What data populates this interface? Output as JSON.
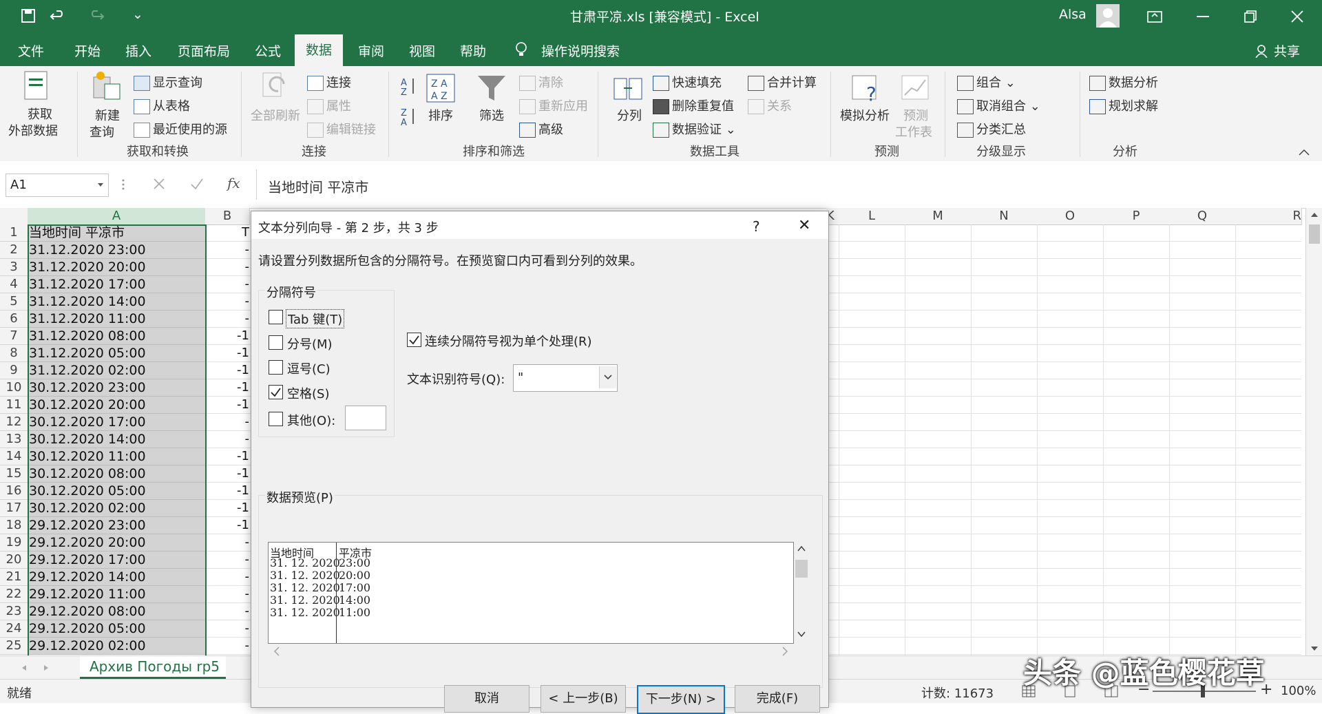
{
  "titlebar": {
    "title": "甘肃平凉.xls [兼容模式] - Excel",
    "user": "Alsa",
    "qat_dropdown": "⌄"
  },
  "tabs": [
    "文件",
    "开始",
    "插入",
    "页面布局",
    "公式",
    "数据",
    "审阅",
    "视图",
    "帮助",
    "操作说明搜索"
  ],
  "share_label": "共享",
  "ribbon": {
    "get_data": "获取\n外部数据",
    "get_data_line1": "获取",
    "get_data_line2": "外部数据",
    "new_query_line1": "新建",
    "new_query_line2": "查询",
    "show_queries": "显示查询",
    "from_table": "从表格",
    "recent_sources": "最近使用的源",
    "group_get_transform": "获取和转换",
    "refresh_all": "全部刷新",
    "connections": "连接",
    "properties": "属性",
    "edit_links": "编辑链接",
    "group_connections": "连接",
    "sort": "排序",
    "filter": "筛选",
    "clear": "清除",
    "reapply": "重新应用",
    "advanced": "高级",
    "group_sort_filter": "排序和筛选",
    "text_to_columns": "分列",
    "flash_fill": "快速填充",
    "remove_duplicates": "删除重复值",
    "data_validation": "数据验证",
    "consolidate": "合并计算",
    "relationships": "关系",
    "group_data_tools": "数据工具",
    "what_if": "模拟分析",
    "forecast_line1": "预测",
    "forecast_line2": "工作表",
    "group_forecast": "预测",
    "group_btn": "组合",
    "ungroup_btn": "取消组合",
    "subtotal": "分类汇总",
    "group_outline": "分级显示",
    "data_analysis": "数据分析",
    "solver": "规划求解",
    "group_analysis": "分析"
  },
  "formula_bar": {
    "name_box": "A1",
    "fx": "fx",
    "content": "当地时间 平凉市"
  },
  "columns": [
    "A",
    "B",
    "K",
    "L",
    "M",
    "N",
    "O",
    "P",
    "Q",
    "R"
  ],
  "rows": [
    {
      "n": "1",
      "a": "当地时间 平凉市",
      "b": "T"
    },
    {
      "n": "2",
      "a": "31.12.2020 23:00",
      "b": "-"
    },
    {
      "n": "3",
      "a": "31.12.2020 20:00",
      "b": "-"
    },
    {
      "n": "4",
      "a": "31.12.2020 17:00",
      "b": "-"
    },
    {
      "n": "5",
      "a": "31.12.2020 14:00",
      "b": "-"
    },
    {
      "n": "6",
      "a": "31.12.2020 11:00",
      "b": "-"
    },
    {
      "n": "7",
      "a": "31.12.2020 08:00",
      "b": "-1"
    },
    {
      "n": "8",
      "a": "31.12.2020 05:00",
      "b": "-1"
    },
    {
      "n": "9",
      "a": "31.12.2020 02:00",
      "b": "-1"
    },
    {
      "n": "10",
      "a": "30.12.2020 23:00",
      "b": "-1"
    },
    {
      "n": "11",
      "a": "30.12.2020 20:00",
      "b": "-1"
    },
    {
      "n": "12",
      "a": "30.12.2020 17:00",
      "b": "-"
    },
    {
      "n": "13",
      "a": "30.12.2020 14:00",
      "b": "-"
    },
    {
      "n": "14",
      "a": "30.12.2020 11:00",
      "b": "-1"
    },
    {
      "n": "15",
      "a": "30.12.2020 08:00",
      "b": "-1"
    },
    {
      "n": "16",
      "a": "30.12.2020 05:00",
      "b": "-1"
    },
    {
      "n": "17",
      "a": "30.12.2020 02:00",
      "b": "-1"
    },
    {
      "n": "18",
      "a": "29.12.2020 23:00",
      "b": "-1"
    },
    {
      "n": "19",
      "a": "29.12.2020 20:00",
      "b": "-"
    },
    {
      "n": "20",
      "a": "29.12.2020 17:00",
      "b": "-"
    },
    {
      "n": "21",
      "a": "29.12.2020 14:00",
      "b": "-"
    },
    {
      "n": "22",
      "a": "29.12.2020 11:00",
      "b": "-"
    },
    {
      "n": "23",
      "a": "29.12.2020 08:00",
      "b": "-"
    },
    {
      "n": "24",
      "a": "29.12.2020 05:00",
      "b": "-"
    },
    {
      "n": "25",
      "a": "29.12.2020 02:00",
      "b": "-"
    }
  ],
  "sheet_tab": "Архив Погоды rp5",
  "status": {
    "ready": "就绪",
    "count": "计数: 11673",
    "zoom": "100%",
    "minus": "−",
    "plus": "+"
  },
  "dialog": {
    "title": "文本分列向导 - 第 2 步，共 3 步",
    "help": "?",
    "close": "✕",
    "instruction": "请设置分列数据所包含的分隔符号。在预览窗口内可看到分列的效果。",
    "delimiters_group": "分隔符号",
    "tab_label": "Tab 键(T)",
    "semicolon_label": "分号(M)",
    "comma_label": "逗号(C)",
    "space_label": "空格(S)",
    "other_label": "其他(O):",
    "consecutive_label": "连续分隔符号视为单个处理(R)",
    "qualifier_label": "文本识别符号(Q):",
    "qualifier_value": "\"",
    "preview_label": "数据预览(P)",
    "preview_col1": [
      "当地时间",
      "31. 12. 2020",
      "31. 12. 2020",
      "31. 12. 2020",
      "31. 12. 2020",
      "31. 12. 2020"
    ],
    "preview_col2": [
      "平凉市",
      "23:00",
      "20:00",
      "17:00",
      "14:00",
      "11:00"
    ],
    "cancel": "取消",
    "back": "< 上一步(B)",
    "next": "下一步(N) >",
    "finish": "完成(F)"
  },
  "watermark": "头条 @蓝色樱花草",
  "colors": {
    "excel_green": "#217346",
    "ribbon_bg": "#f3f3f3",
    "selected_col": "#d3d3d3"
  }
}
